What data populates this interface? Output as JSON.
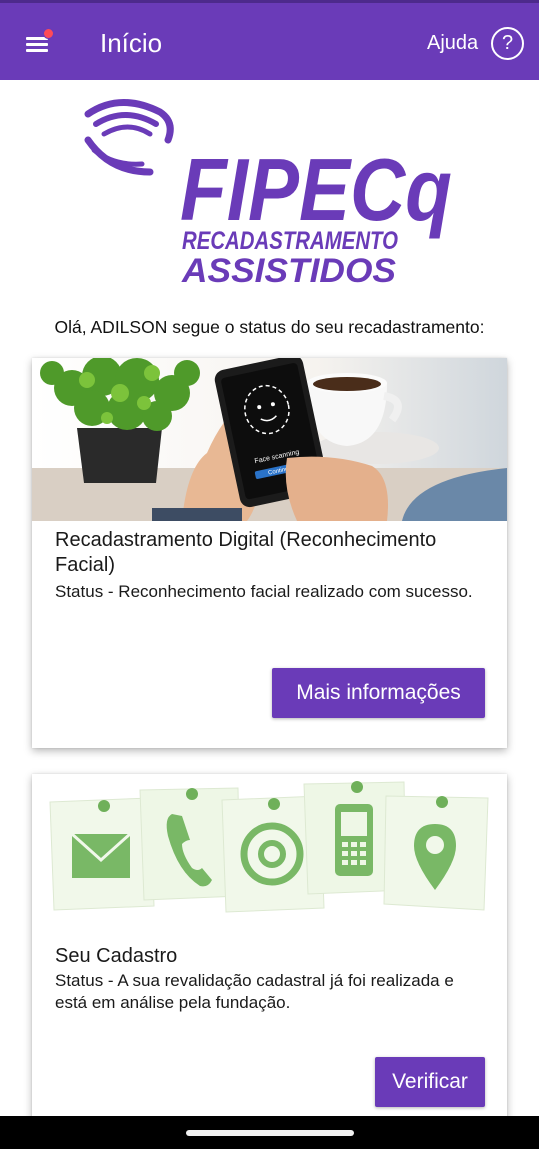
{
  "app_bar": {
    "title": "Início",
    "help_label": "Ajuda",
    "help_icon": "?",
    "background": "#6a3bb8",
    "notification_color": "#ff4a57"
  },
  "logo": {
    "brand": "FIPECq",
    "line1": "RECADASTRAMENTO",
    "line2": "ASSISTIDOS",
    "color": "#6a3bb8"
  },
  "greeting": "Olá, ADILSON segue o status do seu recadastramento:",
  "cards": [
    {
      "image": "face-scanning-phone-photo",
      "phone_text": "Face scanning",
      "phone_button": "Continue",
      "title": "Recadastramento Digital (Reconhecimento Facial)",
      "status": "Status - Reconhecimento facial realizado com sucesso.",
      "button": "Mais informações"
    },
    {
      "image": "contact-notes-illustration",
      "icons": [
        "mail-icon",
        "phone-icon",
        "at-sign-icon",
        "mobile-phone-icon",
        "location-pin-icon"
      ],
      "title": "Seu Cadastro",
      "status": "Status - A sua revalidação cadastral já foi realizada e está em análise pela fundação.",
      "button": "Verificar"
    }
  ]
}
